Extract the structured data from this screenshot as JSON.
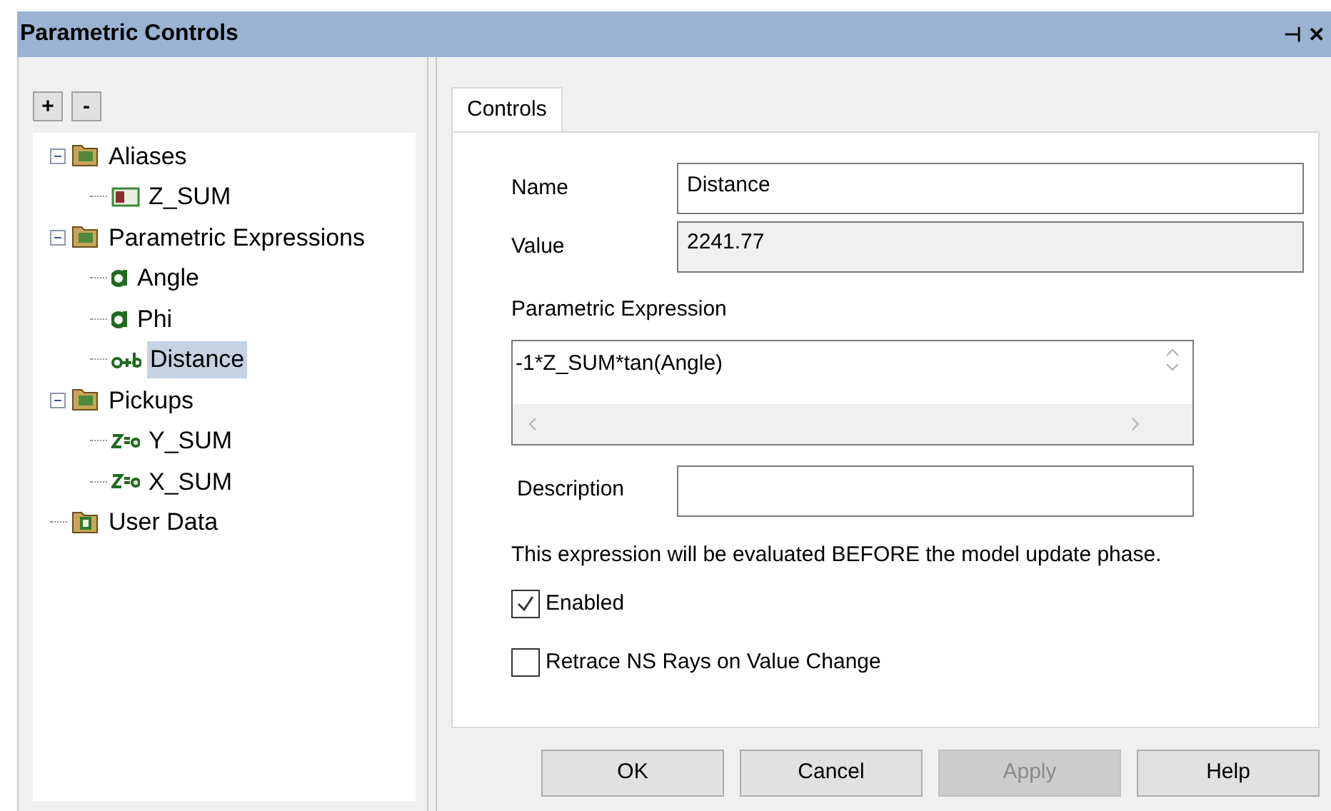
{
  "window": {
    "title": "Parametric Controls",
    "pin_glyph": "⊣",
    "close_glyph": "✕"
  },
  "tree_toolbar": [
    "+",
    "-"
  ],
  "tree": [
    {
      "label": "Aliases",
      "kind": "folder",
      "expanded": true,
      "selected": false,
      "children": [
        {
          "label": "Z_SUM",
          "kind": "alias",
          "selected": false
        }
      ]
    },
    {
      "label": "Parametric Expressions",
      "kind": "folder",
      "expanded": true,
      "selected": false,
      "children": [
        {
          "label": "Angle",
          "kind": "expression",
          "selected": false
        },
        {
          "label": "Phi",
          "kind": "expression",
          "selected": false
        },
        {
          "label": "Distance",
          "kind": "compound",
          "selected": true
        }
      ]
    },
    {
      "label": "Pickups",
      "kind": "folder",
      "expanded": true,
      "selected": false,
      "children": [
        {
          "label": "Y_SUM",
          "kind": "pickup",
          "selected": false
        },
        {
          "label": "X_SUM",
          "kind": "pickup",
          "selected": false
        }
      ]
    },
    {
      "label": "User Data",
      "kind": "document",
      "selected": false
    }
  ],
  "tabs": [
    {
      "label": "Controls",
      "selected": true
    }
  ],
  "form": {
    "name_label": "Name",
    "name_value": "Distance",
    "value_label": "Value",
    "value_value": "2241.77",
    "expression_label": "Parametric Expression",
    "expression_value": "-1*Z_SUM*tan(Angle)",
    "description_label": "Description",
    "note": "This expression will be evaluated BEFORE the model update phase."
  },
  "checkboxes": [
    {
      "label": "Enabled",
      "checked": true
    },
    {
      "label": "Retrace NS Rays on Value Change",
      "checked": false
    }
  ],
  "buttons": [
    {
      "label": "OK",
      "disabled": false
    },
    {
      "label": "Cancel",
      "disabled": false
    },
    {
      "label": "Apply",
      "disabled": true
    },
    {
      "label": "Help",
      "disabled": false
    }
  ]
}
